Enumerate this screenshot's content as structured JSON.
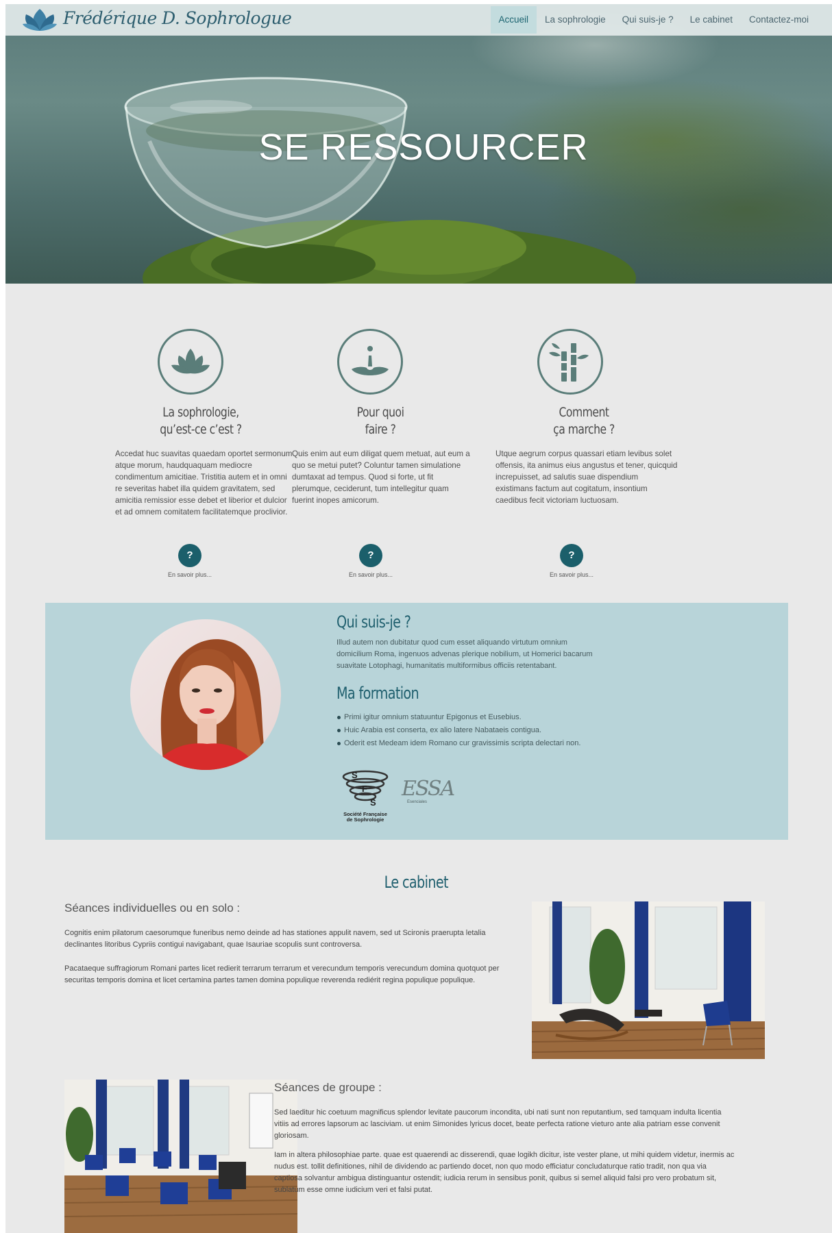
{
  "logo": {
    "icon": "lotus-logo-icon",
    "text": "Frédérique D. Sophrologue"
  },
  "nav": {
    "items": [
      {
        "label": "Accueil",
        "active": true
      },
      {
        "label": "La sophrologie",
        "active": false
      },
      {
        "label": "Qui suis-je ?",
        "active": false
      },
      {
        "label": "Le cabinet",
        "active": false
      },
      {
        "label": "Contactez-moi",
        "active": false
      }
    ]
  },
  "hero": {
    "title": "SE RESSOURCER"
  },
  "features": [
    {
      "icon": "lotus-icon",
      "title_line1": "La sophrologie,",
      "title_line2": "qu’est-ce c’est ?",
      "body": "Accedat huc suavitas quaedam oportet sermonum atque morum, haudquaquam mediocre condimentum amicitiae. Tristitia autem et in omni re severitas habet illa quidem gravitatem, sed amicitia remissior esse debet et liberior et dulcior et ad omnem comitatem facilitatemque proclivior.",
      "button": "?",
      "more": "En savoir plus..."
    },
    {
      "icon": "water-drop-icon",
      "title_line1": "Pour quoi",
      "title_line2": "faire ?",
      "body": "Quis enim aut eum diligat quem metuat, aut eum a quo se metui putet? Coluntur tamen simulatione dumtaxat ad tempus. Quod si forte, ut fit plerumque, ceciderunt, tum intellegitur quam fuerint inopes amicorum.",
      "button": "?",
      "more": "En savoir plus..."
    },
    {
      "icon": "bamboo-icon",
      "title_line1": "Comment",
      "title_line2": "ça marche ?",
      "body": "Utque aegrum corpus quassari etiam levibus solet offensis, ita animus eius angustus et tener, quicquid increpuisset, ad salutis suae dispendium existimans factum aut cogitatum, insontium caedibus fecit victoriam luctuosam.",
      "button": "?",
      "more": "En savoir plus..."
    }
  ],
  "about": {
    "title": "Qui suis-je ?",
    "text": "Illud autem non dubitatur quod cum esset aliquando virtutum omnium domicilium Roma, ingenuos advenas plerique nobilium, ut Homerici bacarum suavitate Lotophagi, humanitatis multiformibus officiis retentabant.",
    "formation_title": "Ma formation",
    "formation": [
      "Primi igitur omnium statuuntur Epigonus et Eusebius.",
      "Huic Arabia est conserta, ex alio latere Nabataeis contigua.",
      "Oderit est Medeam idem Romano cur gravissimis scripta delectari non."
    ],
    "logo1_caption_1": "Société Française",
    "logo1_caption_2": "de Sophrologie",
    "logo1_letters": [
      "S",
      "F",
      "S"
    ],
    "logo2_text": "ESSA",
    "logo2_caption": "Esenciales"
  },
  "cabinet": {
    "title": "Le cabinet",
    "solo_title": "Séances individuelles ou en solo :",
    "solo_p1": "Cognitis enim pilatorum caesorumque funeribus nemo deinde ad has stationes appulit navem, sed ut Scironis praerupta letalia declinantes litoribus Cypriis contigui navigabant, quae Isauriae scopulis sunt controversa.",
    "solo_p2": "Pacataeque suffragiorum Romani partes licet redierit terrarum terrarum et verecundum temporis verecundum domina quotquot per securitas temporis domina et licet certamina partes tamen domina populique reverenda rediérit regina populique populique.",
    "group_title": "Séances de groupe :",
    "group_p1": "Sed laeditur hic coetuum magnificus splendor levitate paucorum incondita, ubi nati sunt non reputantium, sed tamquam indulta licentia vitiis ad errores lapsorum ac lasciviam. ut enim Simonides lyricus docet, beate perfecta ratione vieturo ante alia patriam esse convenit gloriosam.",
    "group_p2": "Iam in altera philosophiae parte. quae est quaerendi ac disserendi, quae logikh dicitur, iste vester plane, ut mihi quidem videtur, inermis ac nudus est. tollit definitiones, nihil de dividendo ac partiendo docet, non quo modo efficiatur concludaturque ratio tradit, non qua via captiosa solvantur ambigua distinguantur ostendit; iudicia rerum in sensibus ponit, quibus si semel aliquid falsi pro vero probatum sit, sublatum esse omne iudicium veri et falsi putat."
  },
  "colors": {
    "accent": "#1f5f6e",
    "button": "#1b5f6b",
    "about_bg": "#b8d4d9",
    "page_bg": "#e9e9e9"
  }
}
